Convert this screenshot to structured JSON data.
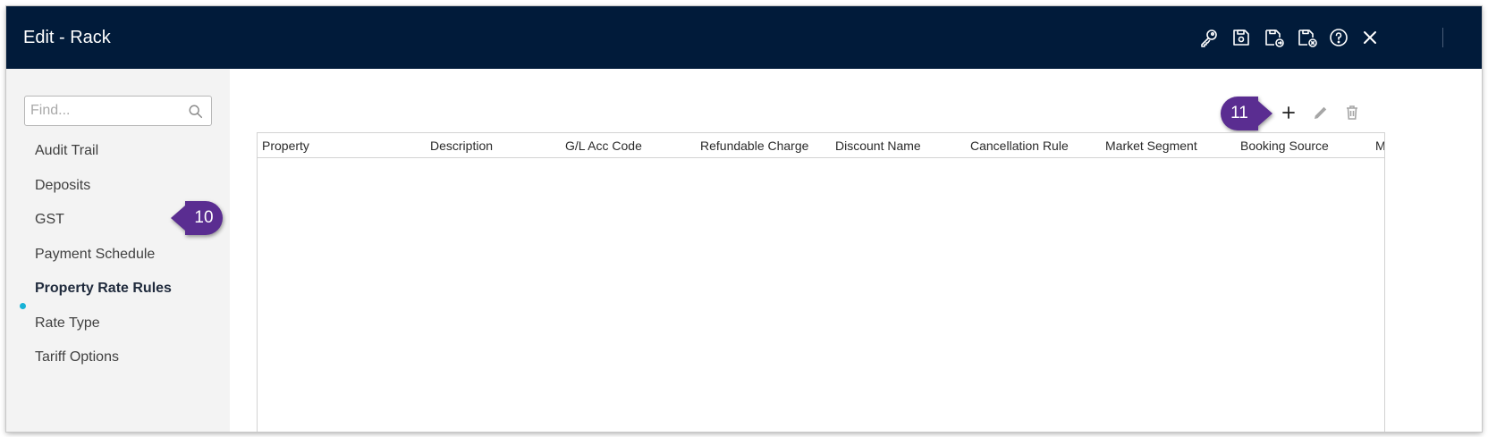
{
  "window": {
    "title": "Edit - Rack"
  },
  "toolbar": {
    "icons": [
      "key-icon",
      "save-icon",
      "save-and-new-icon",
      "save-and-close-icon",
      "help-icon",
      "close-icon"
    ]
  },
  "sidebar": {
    "search_placeholder": "Find...",
    "items": [
      {
        "label": "Audit Trail"
      },
      {
        "label": "Deposits"
      },
      {
        "label": "GST"
      },
      {
        "label": "Payment Schedule"
      },
      {
        "label": "Property Rate Rules",
        "active": true
      },
      {
        "label": "Rate Type"
      },
      {
        "label": "Tariff Options"
      }
    ]
  },
  "callouts": {
    "step_a": "10",
    "step_b": "11"
  },
  "grid": {
    "columns": [
      "Property",
      "Description",
      "G/L Acc Code",
      "Refundable Charge",
      "Discount Name",
      "Cancellation Rule",
      "Market Segment",
      "Booking Source",
      "M"
    ],
    "rows": []
  },
  "colors": {
    "titlebar": "#011b3a",
    "accent_dot": "#17b2d6",
    "callout": "#5a2d91"
  }
}
